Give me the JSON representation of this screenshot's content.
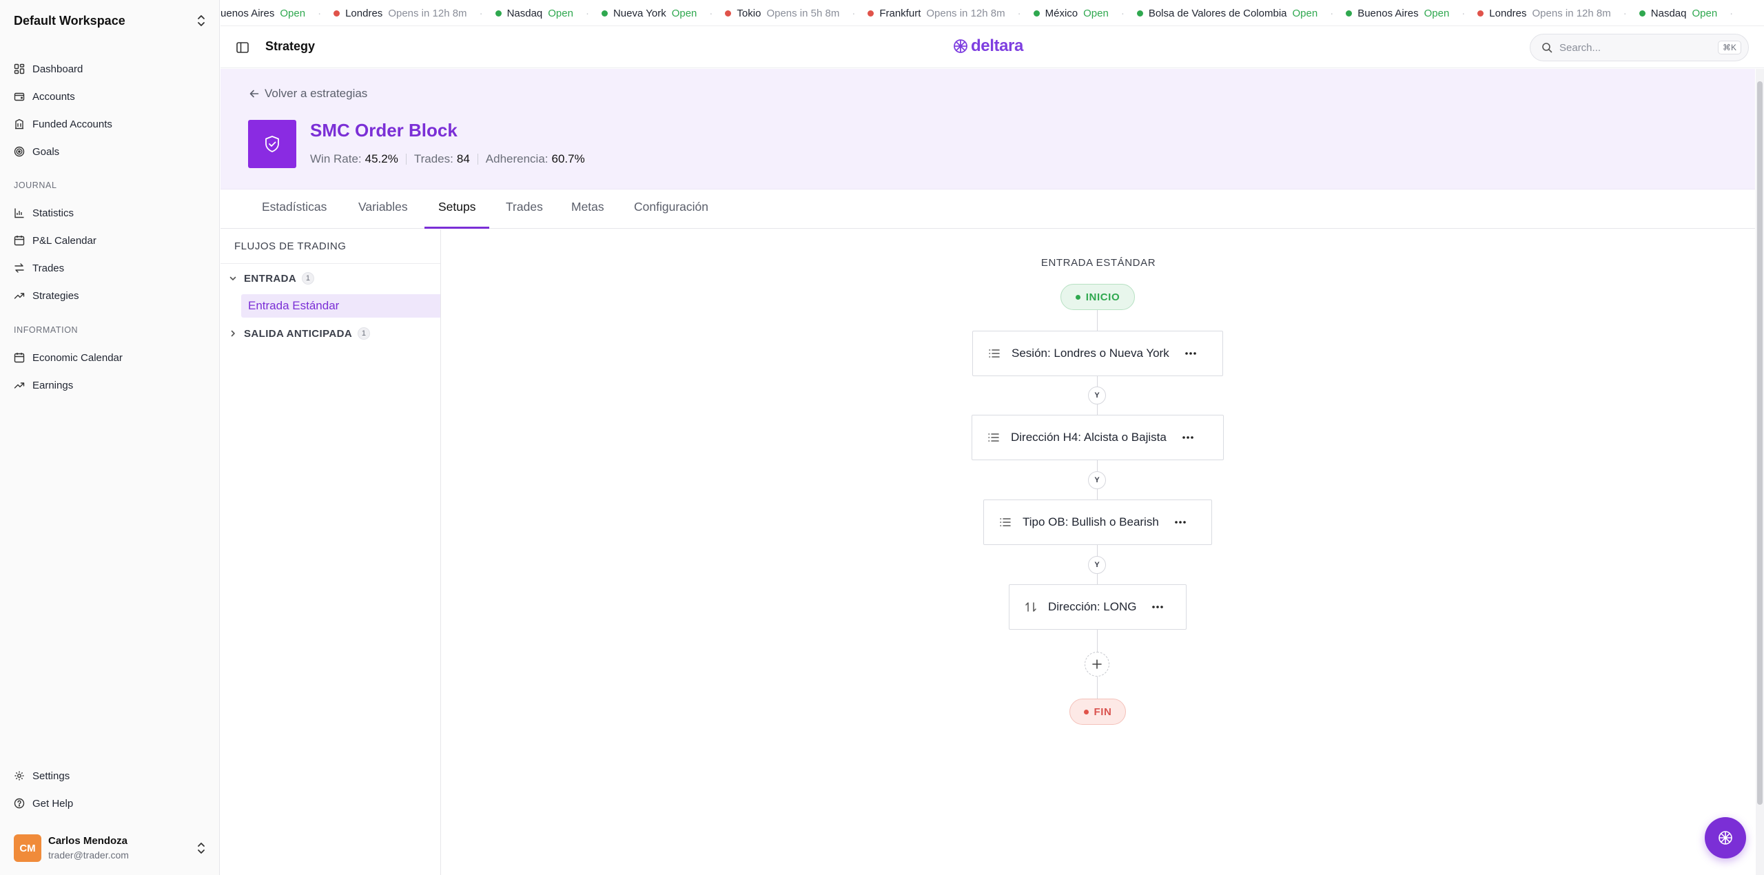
{
  "workspace": {
    "name": "Default Workspace"
  },
  "sidebar": {
    "main": [
      {
        "label": "Dashboard",
        "icon": "dashboard-icon"
      },
      {
        "label": "Accounts",
        "icon": "wallet-icon"
      },
      {
        "label": "Funded Accounts",
        "icon": "building-icon"
      },
      {
        "label": "Goals",
        "icon": "target-icon"
      }
    ],
    "journal_label": "JOURNAL",
    "journal": [
      {
        "label": "Statistics",
        "icon": "bar-chart-icon"
      },
      {
        "label": "P&L Calendar",
        "icon": "calendar-icon"
      },
      {
        "label": "Trades",
        "icon": "swap-icon"
      },
      {
        "label": "Strategies",
        "icon": "trend-icon"
      }
    ],
    "information_label": "INFORMATION",
    "information": [
      {
        "label": "Economic Calendar",
        "icon": "calendar-icon"
      },
      {
        "label": "Earnings",
        "icon": "trend-icon"
      }
    ],
    "footer": [
      {
        "label": "Settings",
        "icon": "gear-icon"
      },
      {
        "label": "Get Help",
        "icon": "help-icon"
      }
    ],
    "user": {
      "initials": "CM",
      "name": "Carlos Mendoza",
      "email": "trader@trader.com"
    }
  },
  "ticker": [
    {
      "name": "Buenos Aires",
      "status": "Open",
      "open": true
    },
    {
      "name": "Londres",
      "status": "Opens in 12h 8m",
      "open": false
    },
    {
      "name": "Nasdaq",
      "status": "Open",
      "open": true
    },
    {
      "name": "Nueva York",
      "status": "Open",
      "open": true
    },
    {
      "name": "Tokio",
      "status": "Opens in 5h 8m",
      "open": false
    },
    {
      "name": "Frankfurt",
      "status": "Opens in 12h 8m",
      "open": false
    },
    {
      "name": "México",
      "status": "Open",
      "open": true
    },
    {
      "name": "Bolsa de Valores de Colombia",
      "status": "Open",
      "open": true
    },
    {
      "name": "Buenos Aires",
      "status": "Open",
      "open": true
    },
    {
      "name": "Londres",
      "status": "Opens in 12h 8m",
      "open": false
    },
    {
      "name": "Nasdaq",
      "status": "Open",
      "open": true
    }
  ],
  "colors": {
    "accent": "#7b2fd6",
    "open": "#2fa84f",
    "closed": "#e0534a"
  },
  "header": {
    "title": "Strategy",
    "brand": "deltara",
    "search_placeholder": "Search...",
    "shortcut": "⌘K"
  },
  "strategy": {
    "back_label": "Volver a estrategias",
    "title": "SMC Order Block",
    "stats": [
      {
        "label": "Win Rate:",
        "value": "45.2%"
      },
      {
        "label": "Trades:",
        "value": "84"
      },
      {
        "label": "Adherencia:",
        "value": "60.7%"
      }
    ]
  },
  "tabs": [
    "Estadísticas",
    "Variables",
    "Setups",
    "Trades",
    "Metas",
    "Configuración"
  ],
  "active_tab": "Setups",
  "flows": {
    "title": "FLUJOS DE TRADING",
    "groups": [
      {
        "name": "ENTRADA",
        "count": "1",
        "expanded": true,
        "items": [
          "Entrada Estándar"
        ]
      },
      {
        "name": "SALIDA ANTICIPADA",
        "count": "1",
        "expanded": false,
        "items": []
      }
    ]
  },
  "canvas": {
    "flow_title": "ENTRADA ESTÁNDAR",
    "start_label": "INICIO",
    "end_label": "FIN",
    "conjunction": "Y",
    "nodes": [
      {
        "label": "Sesión: Londres o Nueva York",
        "icon": "list-icon"
      },
      {
        "label": "Dirección H4: Alcista o Bajista",
        "icon": "list-icon"
      },
      {
        "label": "Tipo OB: Bullish o Bearish",
        "icon": "list-icon"
      },
      {
        "label": "Dirección: LONG",
        "icon": "arrows-up-down-icon"
      }
    ]
  }
}
